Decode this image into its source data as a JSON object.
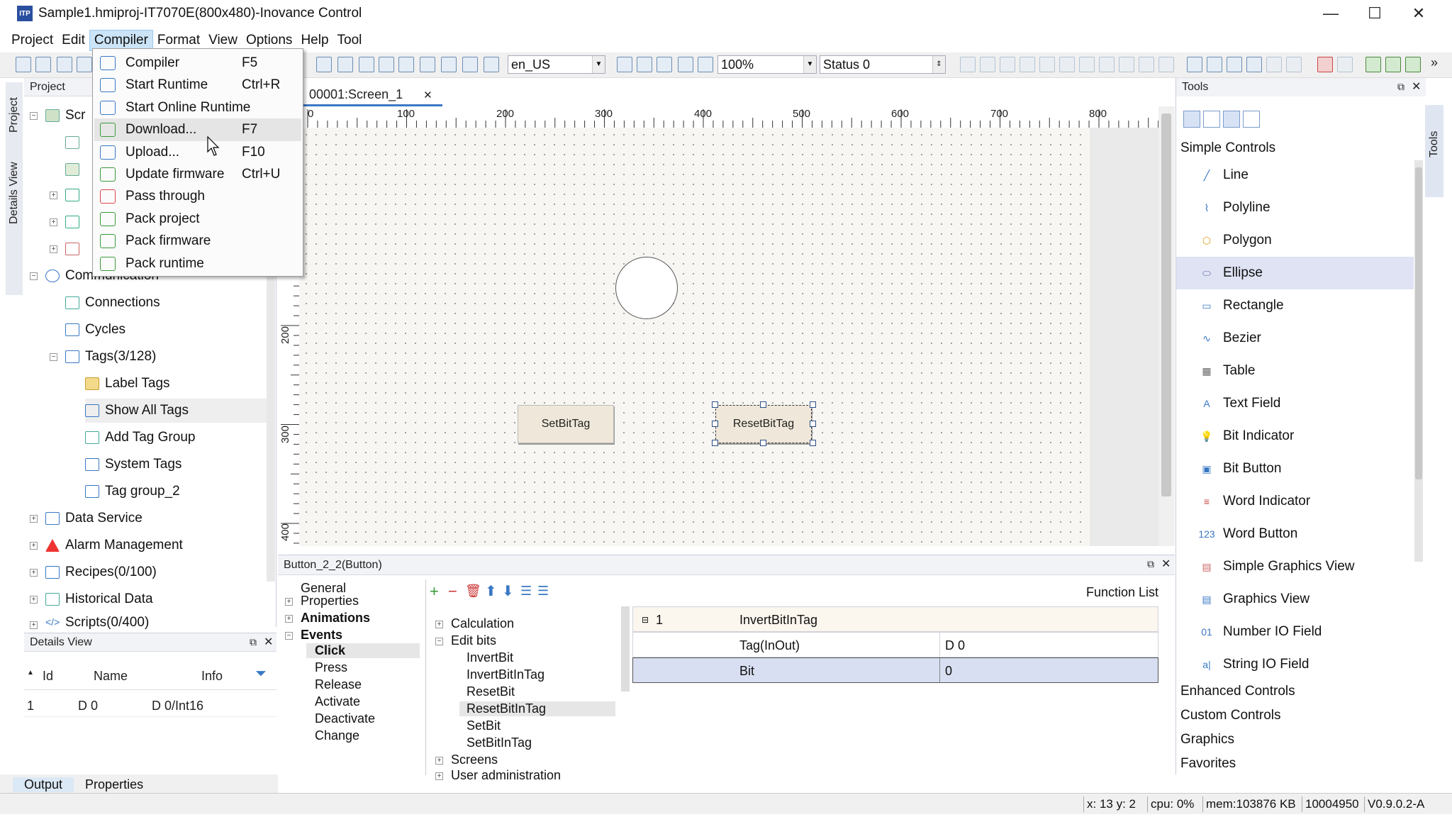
{
  "window": {
    "title": "Sample1.hmiproj-IT7070E(800x480)-Inovance Control",
    "app_icon_label": "ITP",
    "minimize": "—",
    "maximize": "☐",
    "close": "✕"
  },
  "menubar": [
    "Project",
    "Edit",
    "Compiler",
    "Format",
    "View",
    "Options",
    "Help",
    "Tool"
  ],
  "toolbar": {
    "language": "en_US",
    "zoom": "100%",
    "status": "Status 0"
  },
  "compiler_menu": [
    {
      "label": "Compiler",
      "shortcut": "F5",
      "icon": "compiler-icon"
    },
    {
      "label": "Start Runtime",
      "shortcut": "Ctrl+R",
      "icon": "start-runtime-icon"
    },
    {
      "label": "Start Online Runtime",
      "shortcut": "",
      "icon": "start-online-runtime-icon"
    },
    {
      "label": "Download...",
      "shortcut": "F7",
      "icon": "download-icon"
    },
    {
      "label": "Upload...",
      "shortcut": "F10",
      "icon": "upload-icon"
    },
    {
      "label": "Update firmware",
      "shortcut": "Ctrl+U",
      "icon": "update-firmware-icon"
    },
    {
      "label": "Pass through",
      "shortcut": "",
      "icon": "pass-through-icon"
    },
    {
      "label": "Pack project",
      "shortcut": "",
      "icon": "pack-project-icon"
    },
    {
      "label": "Pack firmware",
      "shortcut": "",
      "icon": "pack-firmware-icon"
    },
    {
      "label": "Pack runtime",
      "shortcut": "",
      "icon": "pack-runtime-icon"
    }
  ],
  "side_tabs": {
    "project": "Project",
    "details": "Details View",
    "tools": "Tools"
  },
  "project_panel": {
    "title": "Project",
    "screens_partial": "Scr",
    "communication_partial": "Communication",
    "tree": {
      "connections": "Connections",
      "cycles": "Cycles",
      "tags": "Tags(3/128)",
      "label_tags": "Label Tags",
      "show_all_tags": "Show All Tags",
      "add_tag_group": "Add Tag Group",
      "system_tags": "System Tags",
      "tag_group_2": "Tag group_2",
      "data_service": "Data Service",
      "alarm_management": "Alarm Management",
      "recipes": "Recipes(0/100)",
      "historical_data": "Historical Data",
      "scripts": "Scripts(0/400)"
    }
  },
  "details_view": {
    "title": "Details View",
    "columns": [
      "Id",
      "Name",
      "Info"
    ],
    "rows": [
      {
        "id": "1",
        "name": "D 0",
        "info": "D 0/Int16"
      }
    ]
  },
  "bottom_tabs": [
    "Output",
    "Properties"
  ],
  "editor": {
    "tab_label": "00001:Screen_1",
    "ruler_h": [
      "0",
      "100",
      "200",
      "300",
      "400",
      "500",
      "600",
      "700",
      "800"
    ],
    "ruler_v": [
      "200",
      "300",
      "400"
    ],
    "buttons": {
      "set": "SetBitTag",
      "reset": "ResetBitTag"
    }
  },
  "properties_panel": {
    "title": "Button_2_2(Button)",
    "categories": {
      "general": "General",
      "properties": "Properties",
      "animations": "Animations",
      "events": "Events"
    },
    "events": [
      "Click",
      "Press",
      "Release",
      "Activate",
      "Deactivate",
      "Change"
    ],
    "functions": {
      "calculation": "Calculation",
      "edit_bits": "Edit bits",
      "items": [
        "InvertBit",
        "InvertBitInTag",
        "ResetBit",
        "ResetBitInTag",
        "SetBit",
        "SetBitInTag"
      ],
      "screens": "Screens",
      "user_admin": "User administration"
    },
    "function_list_label": "Function List",
    "function_table": {
      "index": "1",
      "function": "InvertBitInTag",
      "params": [
        {
          "name": "Tag(InOut)",
          "value": "D 0"
        },
        {
          "name": "Bit",
          "value": "0"
        }
      ]
    }
  },
  "tools_panel": {
    "title": "Tools",
    "section_simple": "Simple Controls",
    "simple_controls": [
      "Line",
      "Polyline",
      "Polygon",
      "Ellipse",
      "Rectangle",
      "Bezier",
      "Table",
      "Text Field",
      "Bit Indicator",
      "Bit Button",
      "Word Indicator",
      "Word Button",
      "Simple Graphics View",
      "Graphics View",
      "Number IO Field",
      "String IO Field"
    ],
    "other_sections": [
      "Enhanced Controls",
      "Custom Controls",
      "Graphics",
      "Favorites"
    ]
  },
  "statusbar": {
    "coords": "x: 13 y:   2",
    "cpu": "cpu: 0%",
    "mem": "mem:103876 KB",
    "code": "10004950",
    "version": "V0.9.0.2-A"
  },
  "colors": {
    "accent": "#3c78c4",
    "selected": "#dfe3f4",
    "canvas": "#f8f6f3"
  }
}
